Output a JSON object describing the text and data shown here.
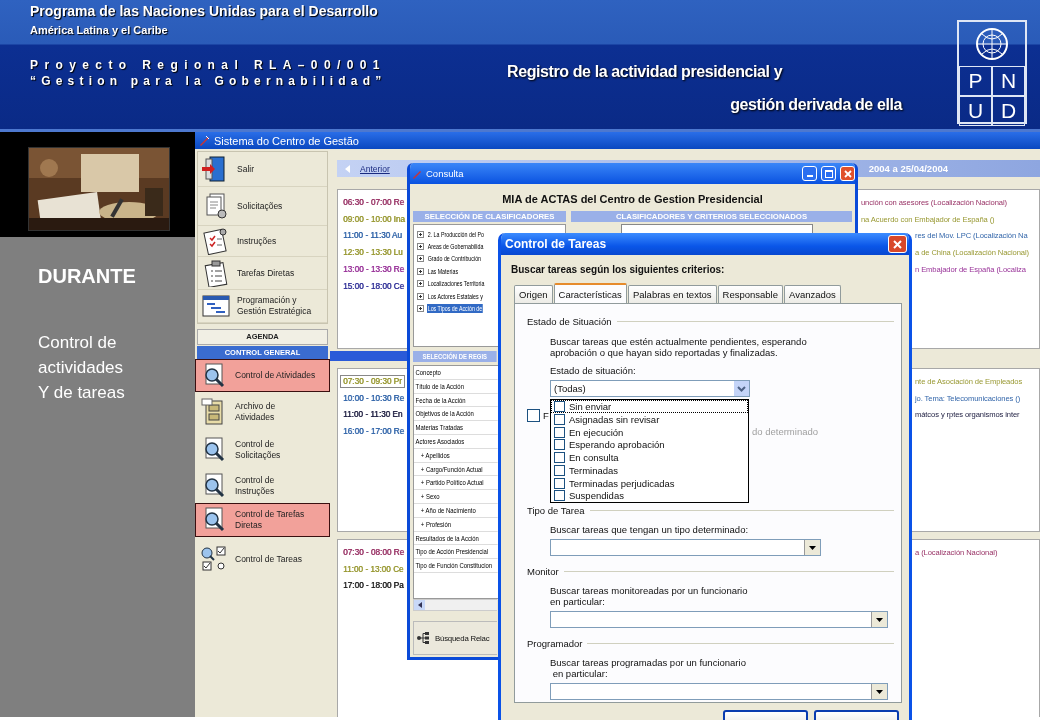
{
  "header": {
    "org": "Programa de las  Naciones Unidas para el  Desarrollo",
    "region": "América Latina y el Caribe",
    "project": "Proyecto Regional RLA–00/001",
    "project_name": "“Gestion para la Gobernabilidad”",
    "title_lines": [
      "Registro de la actividad presidencial y",
      "gestión derivada de ella"
    ],
    "logo_letters": [
      "P",
      "N",
      "U",
      "D"
    ]
  },
  "sidebar": {
    "heading": "DURANTE",
    "text": "Control de\nactividades\nY de tareas"
  },
  "app": {
    "title": "Sistema do Centro de Gestão",
    "nav_items": [
      {
        "label": "Salir",
        "kind": "exit"
      },
      {
        "label": "Solicitações",
        "kind": "documents"
      },
      {
        "label": "Instruções",
        "kind": "instructions"
      },
      {
        "label": "Tarefas Diretas",
        "kind": "tasks"
      },
      {
        "label": "Programación y\nGestión Estratégica",
        "kind": "planning"
      }
    ],
    "agenda": "AGENDA",
    "section": "CONTROL GENERAL",
    "controls": [
      {
        "label": "Control de Atividades",
        "kind": "magnifier",
        "selected": true
      },
      {
        "label": "Archivo de\nAtividades",
        "kind": "cabinet",
        "selected": false
      },
      {
        "label": "Control de\nSolicitações",
        "kind": "magnifier",
        "selected": false
      },
      {
        "label": "Control de\nInstruções",
        "kind": "magnifier",
        "selected": false
      },
      {
        "label": "Control de Tarefas\nDiretas",
        "kind": "magnifier",
        "selected": true
      },
      {
        "label": "Control de Tareas",
        "kind": "tasks-check",
        "selected": false
      }
    ],
    "calendar": {
      "previous": "Anterior",
      "range": "2004 a 25/04/2004",
      "blocks": [
        {
          "rows": [
            {
              "left": "06:30 - 07:00  Re",
              "right": "unción con asesores (Localización Nacional)",
              "color": "#993366",
              "selected": false
            },
            {
              "left": "09:00 - 10:00  Ina",
              "right": "na Acuerdo con Embajador de España ()",
              "color": "#999933",
              "selected": false
            },
            {
              "left": "11:00 - 11:30  Au",
              "right": "res del Mov. LPC (Localización Na",
              "color": "#3366aa",
              "selected": false
            },
            {
              "left": "12:30 - 13:30  Lu",
              "right": "a de China (Localización Nacional)",
              "color": "#999933",
              "selected": false
            },
            {
              "left": "13:00 - 13:30  Re",
              "right": "n Embajador de España (Localiza",
              "color": "#993399",
              "selected": false
            },
            {
              "left": "15:00 - 18:00  Ce",
              "color": "#333399",
              "selected": false
            }
          ]
        },
        {
          "rows": [
            {
              "left": "07:30 - 09:30  Pr",
              "right": "nte de Asociación de Empleados",
              "color": "#999933",
              "selected": true
            },
            {
              "left": "10:00 - 10:30  Re",
              "right": "jo. Tema: Telecomunicaciones ()",
              "color": "#3366aa",
              "selected": false
            },
            {
              "left": "11:00 - 11:30  En",
              "right": "mátcos y rptes organismos inter",
              "color": "#222244",
              "selected": false
            },
            {
              "left": "16:00 - 17:00  Re",
              "color": "#3366aa",
              "selected": false
            }
          ]
        },
        {
          "rows": [
            {
              "left": "07:30 - 08:00  Re",
              "right": "a (Localización Nacional)",
              "color": "#993366",
              "selected": false
            },
            {
              "left": "11:00 - 13:00  Ce",
              "color": "#999933",
              "selected": false
            },
            {
              "left": "17:00 - 18:00  Pa",
              "color": "#222222",
              "selected": false
            }
          ]
        }
      ]
    }
  },
  "consulta": {
    "title": "Consulta",
    "heading": "MIA de ACTAS del Centro de Gestion Presidencial",
    "left_header": "SELECCIÓN DE CLASIFICADORES",
    "right_header": "CLASIFICADORES Y CRITERIOS SELECCIONADOS",
    "tree": [
      {
        "label": "2.  La Producción del Po",
        "selected": false
      },
      {
        "label": "Areas de  Gobernabilida",
        "selected": false
      },
      {
        "label": "Grado de Contribución",
        "selected": false
      },
      {
        "label": "Las Materias",
        "selected": false
      },
      {
        "label": "Localizaciones Territoria",
        "selected": false
      },
      {
        "label": "Los Actores Estatales y",
        "selected": false
      },
      {
        "label": "Los Tipos de Acción de",
        "selected": true
      }
    ],
    "records_header": "SELECCIÓN DE REGIS",
    "records_column": "Concepto",
    "records": [
      {
        "label": "Título de la Acción"
      },
      {
        "label": "Fecha de la Acción"
      },
      {
        "label": "Objetivos de la Acción"
      },
      {
        "label": "Materias Tratadas"
      },
      {
        "label": "Actores Asociados",
        "children": [
          {
            "label": "+ Apellidos"
          },
          {
            "label": "+ Cargo/Función Actual"
          },
          {
            "label": "+ Partido Político Actual"
          },
          {
            "label": "+ Sexo"
          },
          {
            "label": "+ Año de Nacimiento"
          },
          {
            "label": "+ Profesión"
          }
        ]
      },
      {
        "label": "Resultados de la Acción"
      },
      {
        "label": "Tipo de Acción Presidencial"
      },
      {
        "label": "Tipo de Función Constitucion"
      }
    ],
    "search_button": "Búsqueda Relac"
  },
  "tareas": {
    "title": "Control de Tareas",
    "prompt": "Buscar tareas según los siguientes criterios:",
    "tabs": [
      {
        "label": "Origen",
        "selected": false
      },
      {
        "label": "Características",
        "selected": true
      },
      {
        "label": "Palabras en textos",
        "selected": false
      },
      {
        "label": "Responsable",
        "selected": false
      },
      {
        "label": "Avanzados",
        "selected": false
      }
    ],
    "estado": {
      "legend": "Estado de Situación",
      "description": "Buscar tareas que estén actualmente pendientes, esperando\naprobación o que hayan sido reportadas y finalizadas.",
      "label": "Estado de situación:",
      "value": "(Todas)",
      "options": [
        {
          "label": "Sin enviar",
          "checked": false,
          "focused": true
        },
        {
          "label": "Asignadas sin revisar",
          "checked": false,
          "focused": false
        },
        {
          "label": "En ejecución",
          "checked": false,
          "focused": false
        },
        {
          "label": "Esperando aprobación",
          "checked": false,
          "focused": false
        },
        {
          "label": "En consulta",
          "checked": false,
          "focused": false
        },
        {
          "label": "Terminadas",
          "checked": false,
          "focused": false
        },
        {
          "label": "Terminadas perjudicadas",
          "checked": false,
          "focused": false
        },
        {
          "label": "Suspendidas",
          "checked": false,
          "focused": false
        }
      ]
    },
    "hidden_check": {
      "label": "F",
      "checked": false
    },
    "hidden_note": "do determinado",
    "groups": [
      {
        "legend": "Tipo de Tarea",
        "description": "Buscar tareas que tengan un tipo determinado:"
      },
      {
        "legend": "Monitor",
        "description": "Buscar tareas monitoreadas por un funcionario\nen particular:"
      },
      {
        "legend": "Programador",
        "description": "Buscar tareas programadas por un funcionario\n en particular:"
      }
    ],
    "buttons": [
      {
        "kind": "dialog"
      },
      {
        "kind": "dialog"
      }
    ]
  }
}
